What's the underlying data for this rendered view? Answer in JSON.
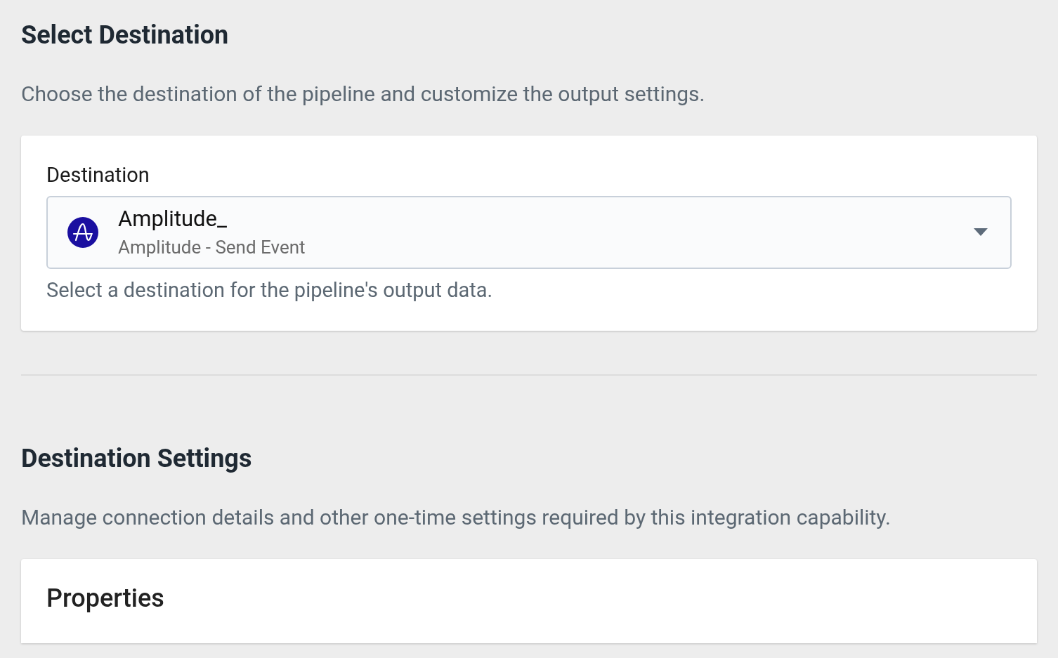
{
  "sections": [
    {
      "title": "Select Destination",
      "description": "Choose the destination of the pipeline and customize the output settings.",
      "card": {
        "kind": "select",
        "label": "Destination",
        "value": "Amplitude_",
        "subvalue": "Amplitude - Send Event",
        "help": "Select a destination for the pipeline's output data."
      }
    },
    {
      "title": "Destination Settings",
      "description": "Manage connection details and other one-time settings required by this integration capability.",
      "card": {
        "kind": "heading",
        "label": "Properties"
      }
    }
  ]
}
